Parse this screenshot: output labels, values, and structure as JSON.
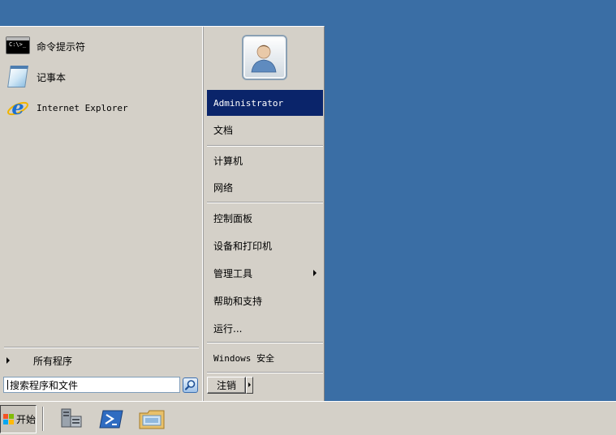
{
  "start_menu": {
    "programs": [
      {
        "label": "命令提示符",
        "icon": "cmd-icon",
        "icon_text": "C:\\>_"
      },
      {
        "label": "记事本",
        "icon": "notepad-icon"
      },
      {
        "label": "Internet Explorer",
        "icon": "ie-icon"
      }
    ],
    "all_programs_label": "所有程序",
    "search_placeholder": "搜索程序和文件",
    "right": {
      "user_icon": "user-avatar-icon",
      "items": [
        {
          "label": "Administrator"
        },
        {
          "label": "文档"
        },
        {
          "label": "计算机"
        },
        {
          "label": "网络"
        },
        {
          "label": "控制面板"
        },
        {
          "label": "设备和打印机"
        },
        {
          "label": "管理工具"
        },
        {
          "label": "帮助和支持"
        },
        {
          "label": "运行..."
        },
        {
          "label": "Windows 安全"
        }
      ]
    },
    "logoff_label": "注销"
  },
  "taskbar": {
    "start_label": "开始",
    "quick_launch": [
      {
        "icon": "server-manager-icon"
      },
      {
        "icon": "powershell-icon"
      },
      {
        "icon": "explorer-folder-icon"
      }
    ]
  },
  "colors": {
    "desktop": "#3a6ea5",
    "menu_face": "#d4d0c8",
    "highlight": "#0a246a"
  }
}
